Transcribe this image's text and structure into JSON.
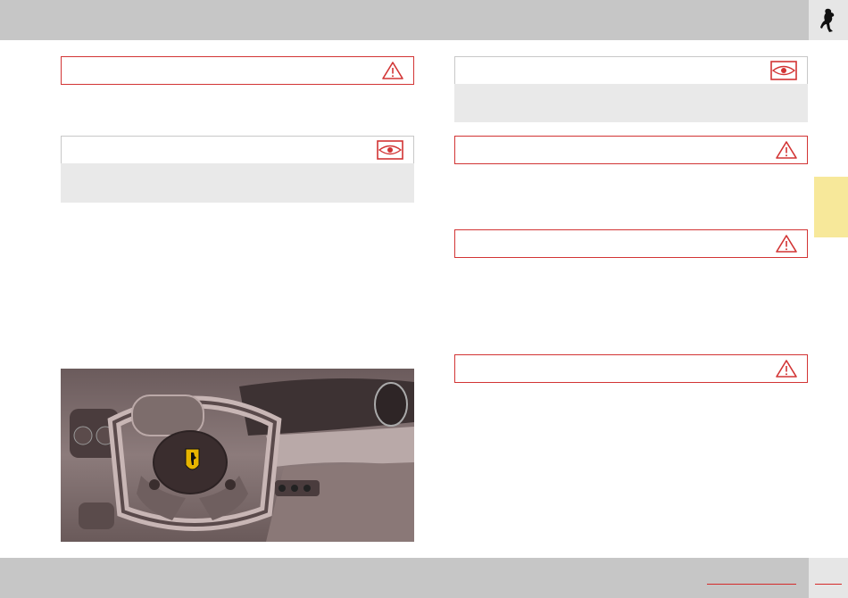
{
  "header": {
    "logo": "prancing-horse-logo"
  },
  "page": {
    "section_tab_color": "#f7e89a",
    "accent": "#d23434"
  },
  "left_column": {
    "warning_box_1": {
      "icon": "warning-triangle-icon"
    },
    "info_box_1": {
      "icon": "eye-icon"
    },
    "photo": {
      "description_icon": "steering-wheel-airbag"
    }
  },
  "right_column": {
    "info_box_1": {
      "icon": "eye-icon"
    },
    "warning_boxes": [
      {
        "icon": "warning-triangle-icon"
      },
      {
        "icon": "warning-triangle-icon"
      },
      {
        "icon": "warning-triangle-icon"
      }
    ]
  }
}
